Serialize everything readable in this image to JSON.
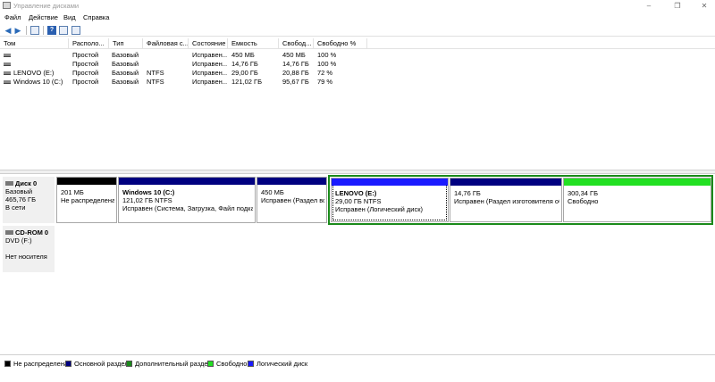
{
  "window": {
    "title": "Управление дисками"
  },
  "controls": {
    "minimize": "–",
    "maximize": "❐",
    "close": "✕"
  },
  "menu": [
    "Файл",
    "Действие",
    "Вид",
    "Справка"
  ],
  "toolbar": {
    "help_label": "?"
  },
  "table": {
    "columns": [
      "Том",
      "Располо...",
      "Тип",
      "Файловая с...",
      "Состояние",
      "Емкость",
      "Свобод...",
      "Свободно %"
    ],
    "rows": [
      [
        "",
        "Простой",
        "Базовый",
        "",
        "Исправен...",
        "450 МБ",
        "450 МБ",
        "100 %"
      ],
      [
        "",
        "Простой",
        "Базовый",
        "",
        "Исправен...",
        "14,76 ГБ",
        "14,76 ГБ",
        "100 %"
      ],
      [
        "LENOVO (E:)",
        "Простой",
        "Базовый",
        "NTFS",
        "Исправен...",
        "29,00 ГБ",
        "20,88 ГБ",
        "72 %"
      ],
      [
        "Windows 10 (C:)",
        "Простой",
        "Базовый",
        "NTFS",
        "Исправен...",
        "121,02 ГБ",
        "95,67 ГБ",
        "79 %"
      ]
    ]
  },
  "disk0": {
    "name": "Диск 0",
    "type": "Базовый",
    "size": "465,76 ГБ",
    "status": "В сети",
    "partitions": [
      {
        "name": "",
        "size": "201 МБ",
        "status": "Не распределена",
        "color": "#000000"
      },
      {
        "name": "Windows 10  (C:)",
        "size": "121,02 ГБ NTFS",
        "status": "Исправен (Система, Загрузка, Файл подкачк",
        "color": "#000080"
      },
      {
        "name": "",
        "size": "450 МБ",
        "status": "Исправен (Раздел вос",
        "color": "#000080"
      },
      {
        "name": "LENOVO  (E:)",
        "size": "29,00 ГБ NTFS",
        "status": "Исправен (Логический диск)",
        "color": "#1a1aff"
      },
      {
        "name": "",
        "size": "14,76 ГБ",
        "status": "Исправен (Раздел изготовителя обо",
        "color": "#000080"
      },
      {
        "name": "",
        "size": "300,34 ГБ",
        "status": "Свободно",
        "color": "#22e022"
      }
    ]
  },
  "cdrom0": {
    "name": "CD-ROM 0",
    "drive": "DVD (F:)",
    "status": "Нет носителя"
  },
  "legend": [
    {
      "label": "Не распределена",
      "color": "#000000"
    },
    {
      "label": "Основной раздел",
      "color": "#000080"
    },
    {
      "label": "Дополнительный раздел",
      "color": "#1a8a1a"
    },
    {
      "label": "Свободно",
      "color": "#22e022"
    },
    {
      "label": "Логический диск",
      "color": "#1a1aff"
    }
  ]
}
